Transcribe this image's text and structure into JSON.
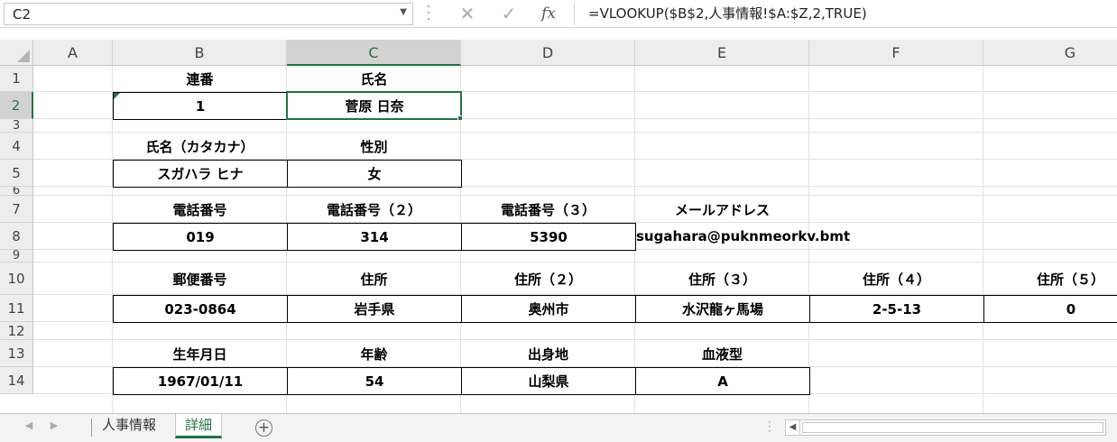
{
  "formula_bar": {
    "name_box": "C2",
    "cancel_icon": "close-icon",
    "enter_icon": "check-icon",
    "fx_label": "fx",
    "formula": "=VLOOKUP($B$2,人事情報!$A:$Z,2,TRUE)"
  },
  "columns": [
    "A",
    "B",
    "C",
    "D",
    "E",
    "F",
    "G"
  ],
  "rows": [
    "1",
    "2",
    "3",
    "4",
    "5",
    "6",
    "7",
    "8",
    "9",
    "10",
    "11",
    "12",
    "13",
    "14"
  ],
  "cells": {
    "B1": "連番",
    "C1": "氏名",
    "B2": "1",
    "C2": "菅原 日奈",
    "B4": "氏名（カタカナ）",
    "C4": "性別",
    "B5": "スガハラ ヒナ",
    "C5": "女",
    "B7": "電話番号",
    "C7": "電話番号（２）",
    "D7": "電話番号（３）",
    "E7": "メールアドレス",
    "B8": "019",
    "C8": "314",
    "D8": "5390",
    "E8": "sugahara@puknmeorkv.bmt",
    "B10": "郵便番号",
    "C10": "住所",
    "D10": "住所（２）",
    "E10": "住所（３）",
    "F10": "住所（４）",
    "G10": "住所（５）",
    "B11": "023-0864",
    "C11": "岩手県",
    "D11": "奥州市",
    "E11": "水沢龍ヶ馬場",
    "F11": "2-5-13",
    "G11": "0",
    "B13": "生年月日",
    "C13": "年齢",
    "D13": "出身地",
    "E13": "血液型",
    "B14": "1967/01/11",
    "C14": "54",
    "D14": "山梨県",
    "E14": "A"
  },
  "sheet_tabs": [
    "人事情報",
    "詳細"
  ],
  "active_sheet": "詳細",
  "colors": {
    "accent": "#217346",
    "header_bg": "#ededed",
    "grid": "#e1e1e1"
  }
}
